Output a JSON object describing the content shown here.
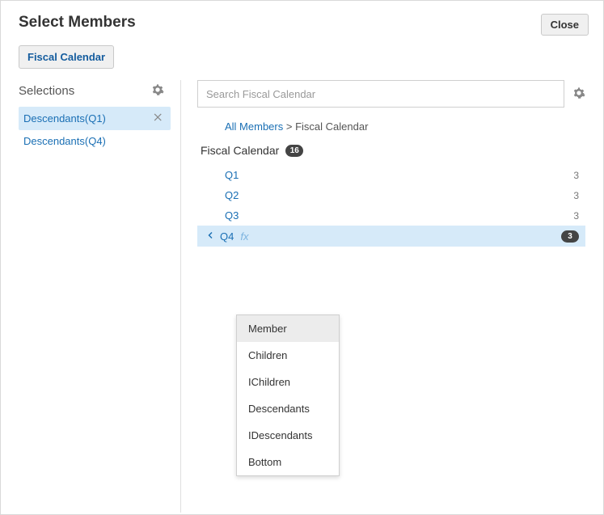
{
  "header": {
    "title": "Select Members",
    "close_label": "Close"
  },
  "tab": {
    "label": "Fiscal Calendar"
  },
  "selections": {
    "heading": "Selections",
    "items": [
      {
        "label": "Descendants(Q1)",
        "active": true
      },
      {
        "label": "Descendants(Q4)",
        "active": false
      }
    ]
  },
  "search": {
    "placeholder": "Search Fiscal Calendar"
  },
  "breadcrumb": {
    "root": "All Members",
    "sep": ">",
    "current": "Fiscal Calendar"
  },
  "tree": {
    "root_label": "Fiscal Calendar",
    "root_count": "16",
    "members": [
      {
        "name": "Q1",
        "count": "3",
        "selected": false
      },
      {
        "name": "Q2",
        "count": "3",
        "selected": false
      },
      {
        "name": "Q3",
        "count": "3",
        "selected": false
      },
      {
        "name": "Q4",
        "count": "3",
        "selected": true
      }
    ]
  },
  "fx_label": "fx",
  "menu": {
    "items": [
      {
        "label": "Member",
        "highlight": true
      },
      {
        "label": "Children",
        "highlight": false
      },
      {
        "label": "IChildren",
        "highlight": false
      },
      {
        "label": "Descendants",
        "highlight": false
      },
      {
        "label": "IDescendants",
        "highlight": false
      },
      {
        "label": "Bottom",
        "highlight": false
      }
    ]
  }
}
